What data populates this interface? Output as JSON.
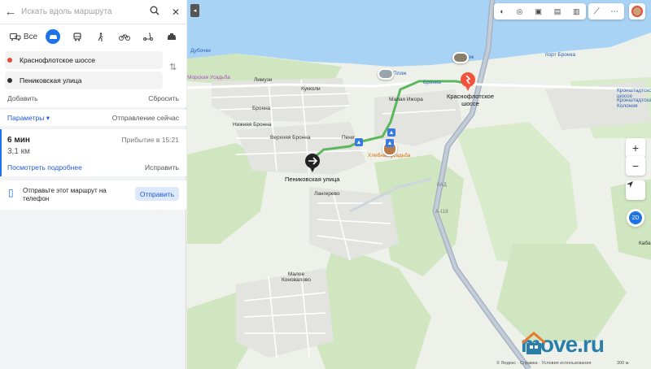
{
  "search": {
    "placeholder": "Искать вдоль маршрута"
  },
  "modes": {
    "all_label": "Все"
  },
  "route": {
    "from": "Краснофлотское шоссе",
    "to": "Пениковская улица",
    "add_label": "Добавить",
    "reset_label": "Сбросить",
    "from_color": "#e8473b",
    "to_color": "#333333"
  },
  "params": {
    "label": "Параметры",
    "departure": "Отправление сейчас"
  },
  "result": {
    "time": "6 мин",
    "arrival": "Прибытие в 15:21",
    "distance": "3,1 км",
    "details_label": "Посмотреть подробнее",
    "fix_label": "Исправить"
  },
  "send": {
    "text": "Отправьте этот маршрут на телефон",
    "button": "Отправить"
  },
  "map": {
    "labels": [
      "Дубочки",
      "Пляж",
      "Пляж",
      "Бронка",
      "порт Бронка",
      "Краснофлотское шоссе",
      "Лимузи",
      "Кукколи",
      "Малая Ижора",
      "Бронна",
      "Нижняя Бронна",
      "Верхняя Бронна",
      "Пени",
      "Хлебная усадьба",
      "Пениковская улица",
      "Лангерево",
      "Малое Коновалово",
      "Кронштадтское шоссе",
      "Кронштадтская Колония",
      "Каба",
      "А-118",
      "КАД",
      "Морская Усадьба"
    ],
    "road_color": "#5cb85c",
    "water_color": "#a9d3f5",
    "route_color": "#5cb85c",
    "scale": "300 м",
    "footer": [
      "© Яндекс",
      "Справка",
      "Условия использования"
    ]
  },
  "watermark": "move.ru"
}
